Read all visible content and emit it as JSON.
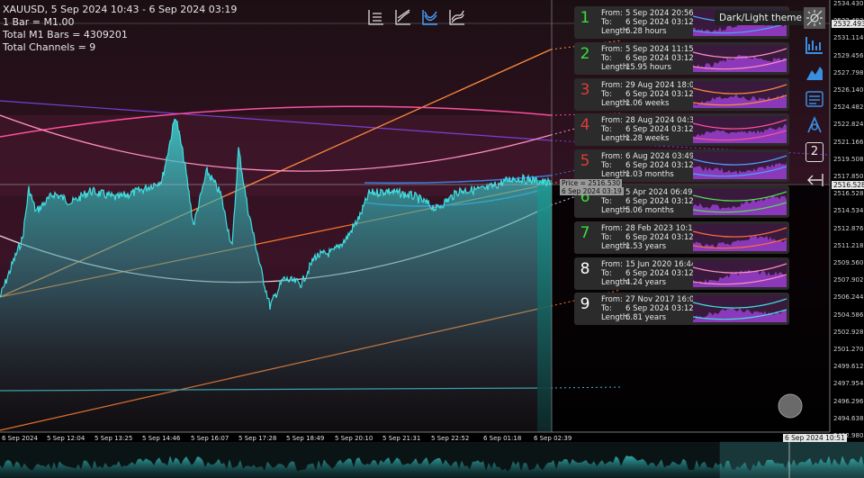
{
  "header": {
    "symbol_range": "XAUUSD, 5 Sep 2024 10:43 - 6 Sep 2024 03:19",
    "bar_info": "1 Bar = M1.00",
    "total_bars": "Total M1 Bars = 4309201",
    "total_channels": "Total Channels = 9"
  },
  "toolbar": {
    "chart_types": [
      {
        "icon": "bars-chart-icon"
      },
      {
        "icon": "line-chart-icon"
      },
      {
        "icon": "curve-chart-icon",
        "active": true
      },
      {
        "icon": "area-chart-icon"
      }
    ]
  },
  "theme_tooltip": "Dark/Light theme",
  "side_toolbar": [
    {
      "icon": "theme-toggle-icon"
    },
    {
      "icon": "histogram-icon"
    },
    {
      "icon": "mountain-chart-icon"
    },
    {
      "icon": "list-view-icon"
    },
    {
      "icon": "eye-icon"
    },
    {
      "icon": "channel-count-icon",
      "label": "2"
    },
    {
      "icon": "collapse-arrow-icon"
    }
  ],
  "channels": [
    {
      "num": "1",
      "color": "#38e038",
      "from": "5 Sep 2024 20:56",
      "to": "6 Sep 2024 03:12",
      "length": "6.28 hours"
    },
    {
      "num": "2",
      "color": "#38e038",
      "from": "5 Sep 2024 11:15",
      "to": "6 Sep 2024 03:12",
      "length": "15.95 hours"
    },
    {
      "num": "3",
      "color": "#e03a3a",
      "from": "29 Aug 2024 18:09",
      "to": "6 Sep 2024 03:12",
      "length": "1.06 weeks"
    },
    {
      "num": "4",
      "color": "#e03a3a",
      "from": "28 Aug 2024 04:35",
      "to": "6 Sep 2024 03:12",
      "length": "1.28 weeks"
    },
    {
      "num": "5",
      "color": "#e03a3a",
      "from": "6 Aug 2024 03:49",
      "to": "6 Sep 2024 03:12",
      "length": "1.03 months"
    },
    {
      "num": "6",
      "color": "#38e038",
      "from": "5 Apr 2024 06:49",
      "to": "6 Sep 2024 03:12",
      "length": "5.06 months"
    },
    {
      "num": "7",
      "color": "#38e038",
      "from": "28 Feb 2023 10:17",
      "to": "6 Sep 2024 03:12",
      "length": "1.53 years"
    },
    {
      "num": "8",
      "color": "#ffffff",
      "from": "15 Jun 2020 16:44",
      "to": "6 Sep 2024 03:12",
      "length": "4.24 years"
    },
    {
      "num": "9",
      "color": "#ffffff",
      "from": "27 Nov 2017 16:05",
      "to": "6 Sep 2024 03:12",
      "length": "6.81 years"
    }
  ],
  "labels": {
    "from": "From:",
    "to": "To:",
    "length": "Length:"
  },
  "price_axis": [
    "2534.430",
    "2532.493",
    "2531.114",
    "2529.456",
    "2527.798",
    "2526.140",
    "2524.482",
    "2522.824",
    "2521.166",
    "2519.508",
    "2517.850",
    "2516.528",
    "2514.534",
    "2512.876",
    "2511.218",
    "2509.560",
    "2507.902",
    "2506.244",
    "2504.586",
    "2502.928",
    "2501.270",
    "2499.612",
    "2497.954",
    "2496.296",
    "2494.638",
    "2492.980"
  ],
  "time_axis": [
    "6 Sep 2024",
    "5 Sep 12:04",
    "5 Sep 13:25",
    "5 Sep 14:46",
    "5 Sep 16:07",
    "5 Sep 17:28",
    "5 Sep 18:49",
    "5 Sep 20:10",
    "5 Sep 21:31",
    "5 Sep 22:52",
    "6 Sep 01:18",
    "6 Sep 02:39"
  ],
  "cursor": {
    "price": "Price = 2516.530",
    "time": "6 Sep 2024 03:19",
    "price_axis_tag": "2516.528",
    "top_axis_tag": "2532.493"
  },
  "navigator_time_tag": "6 Sep 2024 10:51"
}
